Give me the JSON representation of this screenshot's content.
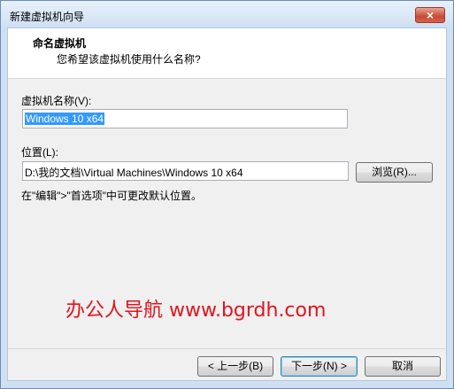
{
  "window": {
    "title": "新建虚拟机向导",
    "close_glyph": "×"
  },
  "header": {
    "title": "命名虚拟机",
    "subtitle": "您希望该虚拟机使用什么名称?"
  },
  "form": {
    "name_label": "虚拟机名称(V):",
    "name_value": "Windows 10 x64",
    "location_label": "位置(L):",
    "location_value": "D:\\我的文档\\Virtual Machines\\Windows 10 x64",
    "browse_label": "浏览(R)...",
    "hint": "在\"编辑\">\"首选项\"中可更改默认位置。"
  },
  "footer": {
    "back_label": "< 上一步(B)",
    "next_label": "下一步(N) >",
    "cancel_label": "取消"
  },
  "watermark": "办公人导航 www.bgrdh.com",
  "colors": {
    "accent": "#3399ff",
    "watermark": "#e0141e",
    "frame": "#cfe0f3",
    "close": "#c74a35"
  }
}
